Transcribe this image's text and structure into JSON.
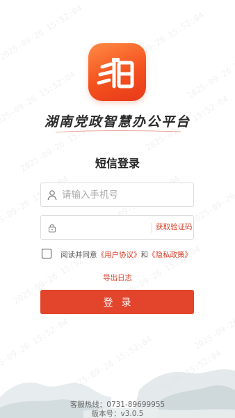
{
  "app": {
    "logo_name": "app-logo",
    "slogan": "湖南党政智慧办公平台",
    "brand_color": "#e2442c"
  },
  "login": {
    "title": "短信登录",
    "phone_placeholder": "请输入手机号",
    "code_placeholder": "",
    "get_code_label": "获取验证码",
    "agreement_prefix": "阅读并同意",
    "user_agreement": "《用户协议》",
    "agreement_and": "和",
    "privacy_policy": "《隐私政策》",
    "agreement_checked": false,
    "export_logs_label": "导出日志",
    "login_button_label": "登录"
  },
  "footer": {
    "hotline": "客服热线：0731-89699955",
    "version": "版本号：v3.0.5"
  },
  "watermark": {
    "text": "2025-09-26 15:52:04"
  }
}
